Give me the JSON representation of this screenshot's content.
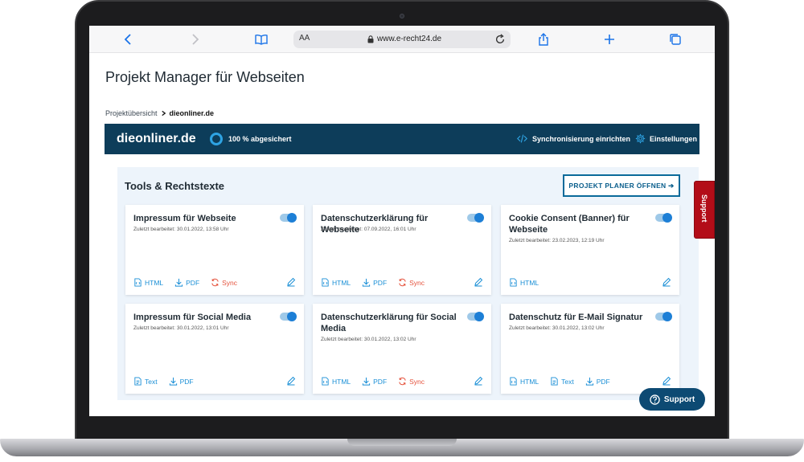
{
  "browser": {
    "url": "www.e-recht24.de",
    "text_size_label": "AA"
  },
  "page": {
    "title": "Projekt Manager für Webseiten",
    "breadcrumb": {
      "parent": "Projektübersicht",
      "current": "dieonliner.de"
    }
  },
  "project_banner": {
    "name": "dieonliner.de",
    "secured_status": "100 % abgesichert",
    "sync_label": "Synchronisierung einrichten",
    "settings_label": "Einstellungen",
    "colors": {
      "background": "#0d3d5a",
      "accent": "#2ea3e3"
    }
  },
  "tools": {
    "title": "Tools & Rechtstexte",
    "planer_button": "PROJEKT PLANER ÖFFNEN ➔",
    "cards": [
      {
        "title": "Impressum für Webseite",
        "edited": "Zuletzt bearbeitet: 30.01.2022, 13:58 Uhr",
        "enabled": true,
        "actions": [
          "HTML",
          "PDF",
          "Sync"
        ]
      },
      {
        "title": "Datenschutzerklärung für Webseite",
        "edited": "Zuletzt bearbeitet: 07.09.2022, 16:01 Uhr",
        "enabled": true,
        "actions": [
          "HTML",
          "PDF",
          "Sync"
        ]
      },
      {
        "title": "Cookie Consent (Banner) für Webseite",
        "edited": "Zuletzt bearbeitet: 23.02.2023, 12:19 Uhr",
        "enabled": true,
        "actions": [
          "HTML"
        ]
      },
      {
        "title": "Impressum für Social Media",
        "edited": "Zuletzt bearbeitet: 30.01.2022, 13:01 Uhr",
        "enabled": true,
        "actions": [
          "Text",
          "PDF"
        ]
      },
      {
        "title": "Datenschutzerklärung für Social Media",
        "edited": "Zuletzt bearbeitet: 30.01.2022, 13:02 Uhr",
        "enabled": true,
        "actions": [
          "HTML",
          "PDF",
          "Sync"
        ]
      },
      {
        "title": "Datenschutz für E-Mail Signatur",
        "edited": "Zuletzt bearbeitet: 30.01.2022, 13:02 Uhr",
        "enabled": true,
        "actions": [
          "HTML",
          "Text",
          "PDF"
        ]
      }
    ]
  },
  "support": {
    "side_tab": "Support",
    "floating_button": "Support",
    "colors": {
      "side_tab": "#b30d18",
      "floating_button": "#0d4a73"
    }
  }
}
